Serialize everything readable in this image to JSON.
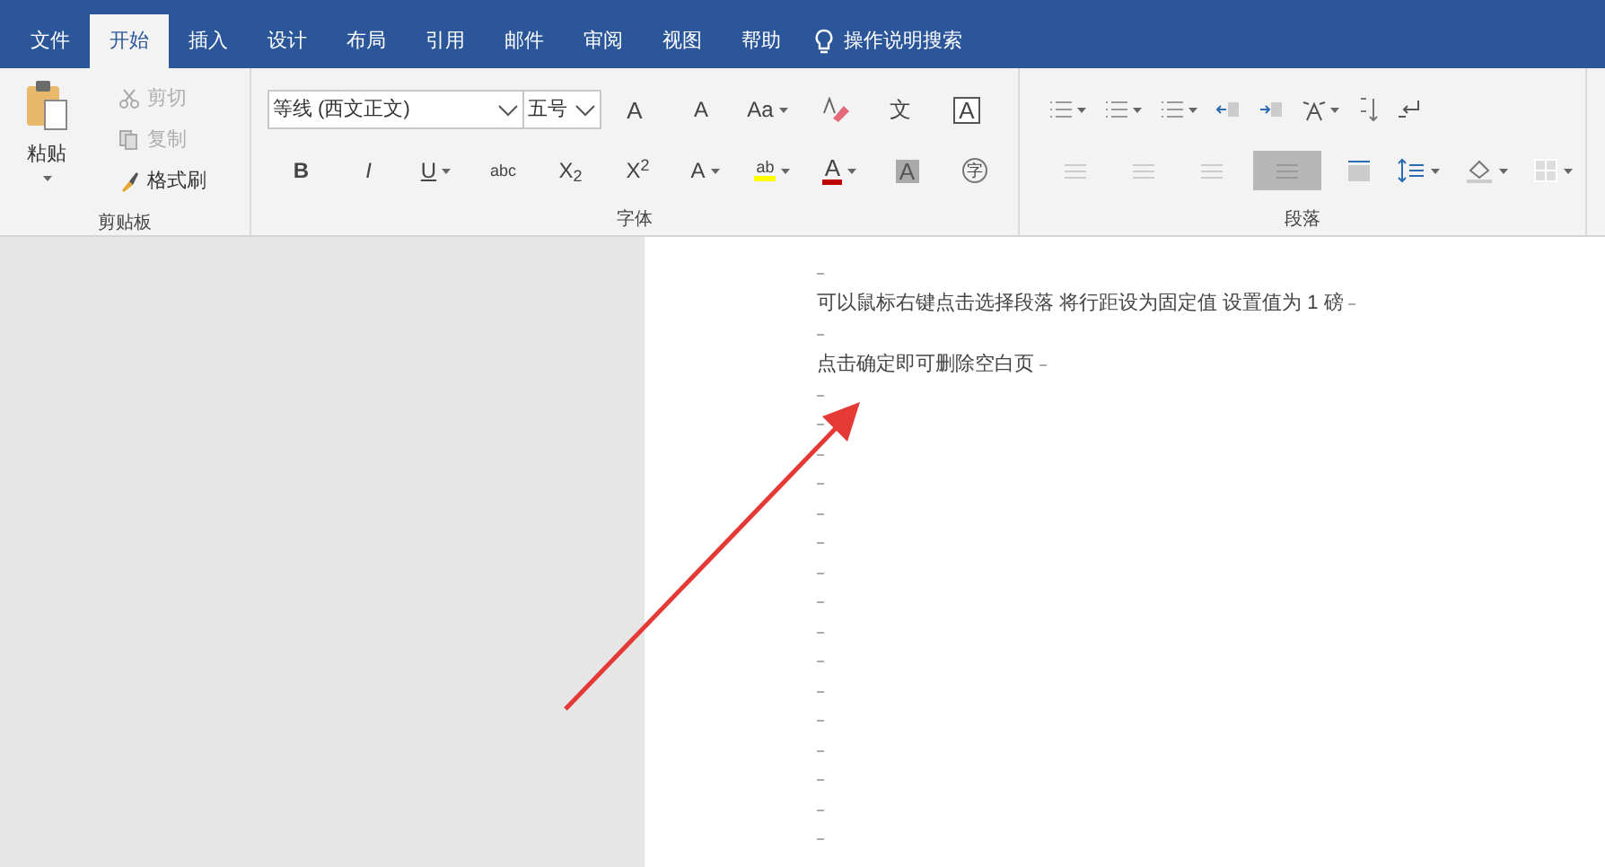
{
  "tabs": [
    {
      "label": "文件",
      "selected": false
    },
    {
      "label": "开始",
      "selected": true
    },
    {
      "label": "插入",
      "selected": false
    },
    {
      "label": "设计",
      "selected": false
    },
    {
      "label": "布局",
      "selected": false
    },
    {
      "label": "引用",
      "selected": false
    },
    {
      "label": "邮件",
      "selected": false
    },
    {
      "label": "审阅",
      "selected": false
    },
    {
      "label": "视图",
      "selected": false
    },
    {
      "label": "帮助",
      "selected": false
    }
  ],
  "tell_me": "操作说明搜索",
  "clipboard": {
    "paste": "粘贴",
    "actions": [
      {
        "label": "剪切",
        "disabled": true
      },
      {
        "label": "复制",
        "disabled": true
      },
      {
        "label": "格式刷",
        "disabled": false
      }
    ],
    "group_label": "剪贴板"
  },
  "font": {
    "font_name": "等线 (西文正文)",
    "font_size": "五号",
    "group_label": "字体",
    "row1": [
      {
        "kind": "text",
        "label": "A"
      },
      {
        "kind": "text",
        "label": "A"
      },
      {
        "kind": "text",
        "label": "Aa",
        "dropdown": true
      },
      {
        "kind": "eraser"
      },
      {
        "kind": "text",
        "label": "文"
      },
      {
        "kind": "boxed",
        "label": "A"
      }
    ],
    "row2": [
      {
        "kind": "text",
        "label": "B"
      },
      {
        "kind": "text",
        "label": "I"
      },
      {
        "kind": "text",
        "label": "U",
        "dropdown": true
      },
      {
        "kind": "text",
        "label": "abc"
      },
      {
        "kind": "rich",
        "label": "X$_{2}$"
      },
      {
        "kind": "rich",
        "label": "X$^{2}$"
      },
      {
        "kind": "text",
        "label": "A",
        "dropdown": true
      },
      {
        "kind": "highlight",
        "label": "ab",
        "dropdown": true
      },
      {
        "kind": "color",
        "label": "A",
        "dropdown": true
      },
      {
        "kind": "shaded",
        "label": "A"
      },
      {
        "kind": "circled",
        "label": "字"
      }
    ]
  },
  "paragraph": {
    "group_label": "段落",
    "alignment": [
      {
        "selected": false
      },
      {
        "selected": false
      },
      {
        "selected": false
      },
      {
        "selected": true
      }
    ]
  },
  "document": {
    "paragraphs": [
      {
        "kind": "blank"
      },
      {
        "kind": "text",
        "text": "可以鼠标右键点击选择段落 将行距设为固定值 设置值为 1 磅"
      },
      {
        "kind": "blank"
      },
      {
        "kind": "text",
        "text": "点击确定即可删除空白页"
      },
      {
        "kind": "blank"
      },
      {
        "kind": "blank"
      },
      {
        "kind": "blank"
      },
      {
        "kind": "blank"
      },
      {
        "kind": "blank"
      },
      {
        "kind": "blank"
      },
      {
        "kind": "blank"
      },
      {
        "kind": "blank"
      },
      {
        "kind": "blank"
      },
      {
        "kind": "blank"
      },
      {
        "kind": "blank"
      },
      {
        "kind": "blank"
      },
      {
        "kind": "blank"
      },
      {
        "kind": "blank"
      },
      {
        "kind": "blank"
      },
      {
        "kind": "blank"
      }
    ]
  }
}
